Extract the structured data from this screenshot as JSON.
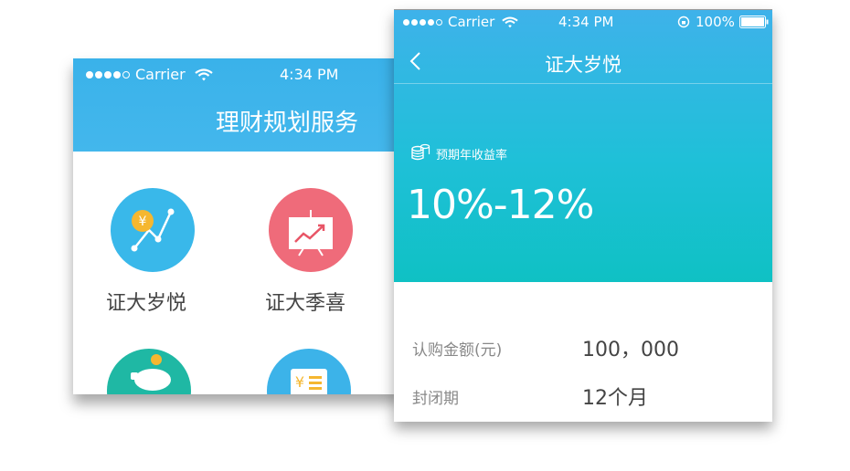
{
  "back_screen": {
    "status_bar": {
      "carrier": "Carrier",
      "time": "4:34 PM"
    },
    "title": "理财规划服务",
    "tiles": [
      {
        "label": "证大岁悦",
        "icon": "chart-line-yen-icon",
        "color": "#39b8ea"
      },
      {
        "label": "证大季喜",
        "icon": "presentation-board-icon",
        "color": "#ef6b7a"
      },
      {
        "label": "",
        "icon": "piggy-bank-icon",
        "color": "#1fb8a4"
      },
      {
        "label": "",
        "icon": "yen-document-icon",
        "color": "#3cb3e9"
      }
    ]
  },
  "front_screen": {
    "status_bar": {
      "carrier": "Carrier",
      "time": "4:34 PM",
      "battery": "100%"
    },
    "title": "证大岁悦",
    "rate_label": "预期年收益率",
    "rate_value": "10%-12%",
    "details": [
      {
        "label": "认购金额(元)",
        "value": "100，000"
      },
      {
        "label": "封闭期",
        "value": "12个月"
      }
    ]
  },
  "colors": {
    "header_blue": "#3ab2ea",
    "teal": "#0fc1c4"
  }
}
